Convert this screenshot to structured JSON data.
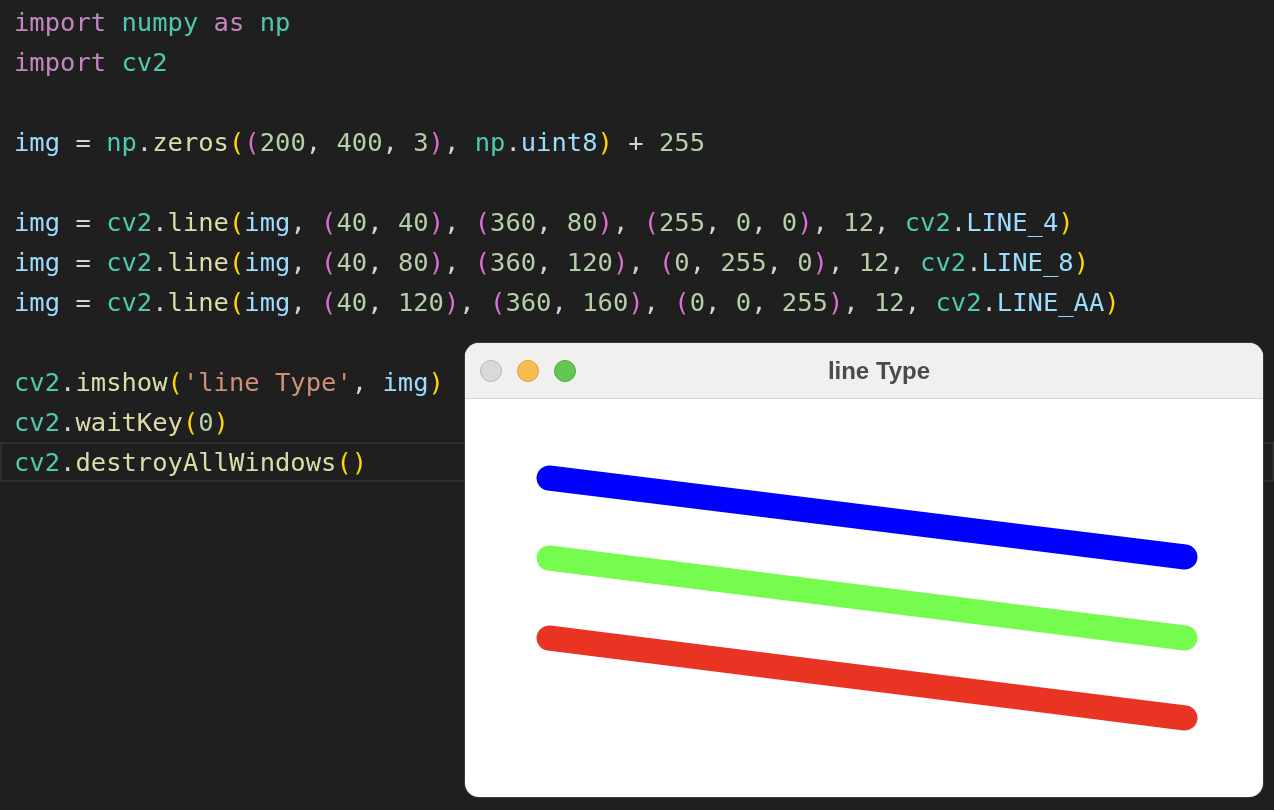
{
  "editor": {
    "lines": [
      {
        "kind": "code",
        "current": false,
        "tokens": [
          {
            "kind": "kw",
            "t": "import "
          },
          {
            "kind": "mod",
            "t": "numpy "
          },
          {
            "kind": "kw",
            "t": "as "
          },
          {
            "kind": "mod",
            "t": "np"
          }
        ]
      },
      {
        "kind": "code",
        "current": false,
        "tokens": [
          {
            "kind": "kw",
            "t": "import "
          },
          {
            "kind": "mod",
            "t": "cv2"
          }
        ]
      },
      {
        "kind": "blank",
        "current": false
      },
      {
        "kind": "code",
        "current": false,
        "tokens": [
          {
            "kind": "var",
            "t": "img"
          },
          {
            "kind": "op",
            "t": " = "
          },
          {
            "kind": "mod",
            "t": "np"
          },
          {
            "kind": "op",
            "t": "."
          },
          {
            "kind": "fn",
            "t": "zeros"
          },
          {
            "kind": "p1",
            "t": "("
          },
          {
            "kind": "p2",
            "t": "("
          },
          {
            "kind": "num",
            "t": "200"
          },
          {
            "kind": "op",
            "t": ", "
          },
          {
            "kind": "num",
            "t": "400"
          },
          {
            "kind": "op",
            "t": ", "
          },
          {
            "kind": "num",
            "t": "3"
          },
          {
            "kind": "p2",
            "t": ")"
          },
          {
            "kind": "op",
            "t": ", "
          },
          {
            "kind": "mod",
            "t": "np"
          },
          {
            "kind": "op",
            "t": "."
          },
          {
            "kind": "var",
            "t": "uint8"
          },
          {
            "kind": "p1",
            "t": ")"
          },
          {
            "kind": "op",
            "t": " + "
          },
          {
            "kind": "num",
            "t": "255"
          }
        ]
      },
      {
        "kind": "blank",
        "current": false
      },
      {
        "kind": "code",
        "current": false,
        "tokens": [
          {
            "kind": "var",
            "t": "img"
          },
          {
            "kind": "op",
            "t": " = "
          },
          {
            "kind": "mod",
            "t": "cv2"
          },
          {
            "kind": "op",
            "t": "."
          },
          {
            "kind": "fn",
            "t": "line"
          },
          {
            "kind": "p1",
            "t": "("
          },
          {
            "kind": "var",
            "t": "img"
          },
          {
            "kind": "op",
            "t": ", "
          },
          {
            "kind": "p2",
            "t": "("
          },
          {
            "kind": "num",
            "t": "40"
          },
          {
            "kind": "op",
            "t": ", "
          },
          {
            "kind": "num",
            "t": "40"
          },
          {
            "kind": "p2",
            "t": ")"
          },
          {
            "kind": "op",
            "t": ", "
          },
          {
            "kind": "p2",
            "t": "("
          },
          {
            "kind": "num",
            "t": "360"
          },
          {
            "kind": "op",
            "t": ", "
          },
          {
            "kind": "num",
            "t": "80"
          },
          {
            "kind": "p2",
            "t": ")"
          },
          {
            "kind": "op",
            "t": ", "
          },
          {
            "kind": "p2",
            "t": "("
          },
          {
            "kind": "num",
            "t": "255"
          },
          {
            "kind": "op",
            "t": ", "
          },
          {
            "kind": "num",
            "t": "0"
          },
          {
            "kind": "op",
            "t": ", "
          },
          {
            "kind": "num",
            "t": "0"
          },
          {
            "kind": "p2",
            "t": ")"
          },
          {
            "kind": "op",
            "t": ", "
          },
          {
            "kind": "num",
            "t": "12"
          },
          {
            "kind": "op",
            "t": ", "
          },
          {
            "kind": "mod",
            "t": "cv2"
          },
          {
            "kind": "op",
            "t": "."
          },
          {
            "kind": "var",
            "t": "LINE_4"
          },
          {
            "kind": "p1",
            "t": ")"
          }
        ]
      },
      {
        "kind": "code",
        "current": false,
        "tokens": [
          {
            "kind": "var",
            "t": "img"
          },
          {
            "kind": "op",
            "t": " = "
          },
          {
            "kind": "mod",
            "t": "cv2"
          },
          {
            "kind": "op",
            "t": "."
          },
          {
            "kind": "fn",
            "t": "line"
          },
          {
            "kind": "p1",
            "t": "("
          },
          {
            "kind": "var",
            "t": "img"
          },
          {
            "kind": "op",
            "t": ", "
          },
          {
            "kind": "p2",
            "t": "("
          },
          {
            "kind": "num",
            "t": "40"
          },
          {
            "kind": "op",
            "t": ", "
          },
          {
            "kind": "num",
            "t": "80"
          },
          {
            "kind": "p2",
            "t": ")"
          },
          {
            "kind": "op",
            "t": ", "
          },
          {
            "kind": "p2",
            "t": "("
          },
          {
            "kind": "num",
            "t": "360"
          },
          {
            "kind": "op",
            "t": ", "
          },
          {
            "kind": "num",
            "t": "120"
          },
          {
            "kind": "p2",
            "t": ")"
          },
          {
            "kind": "op",
            "t": ", "
          },
          {
            "kind": "p2",
            "t": "("
          },
          {
            "kind": "num",
            "t": "0"
          },
          {
            "kind": "op",
            "t": ", "
          },
          {
            "kind": "num",
            "t": "255"
          },
          {
            "kind": "op",
            "t": ", "
          },
          {
            "kind": "num",
            "t": "0"
          },
          {
            "kind": "p2",
            "t": ")"
          },
          {
            "kind": "op",
            "t": ", "
          },
          {
            "kind": "num",
            "t": "12"
          },
          {
            "kind": "op",
            "t": ", "
          },
          {
            "kind": "mod",
            "t": "cv2"
          },
          {
            "kind": "op",
            "t": "."
          },
          {
            "kind": "var",
            "t": "LINE_8"
          },
          {
            "kind": "p1",
            "t": ")"
          }
        ]
      },
      {
        "kind": "code",
        "current": false,
        "tokens": [
          {
            "kind": "var",
            "t": "img"
          },
          {
            "kind": "op",
            "t": " = "
          },
          {
            "kind": "mod",
            "t": "cv2"
          },
          {
            "kind": "op",
            "t": "."
          },
          {
            "kind": "fn",
            "t": "line"
          },
          {
            "kind": "p1",
            "t": "("
          },
          {
            "kind": "var",
            "t": "img"
          },
          {
            "kind": "op",
            "t": ", "
          },
          {
            "kind": "p2",
            "t": "("
          },
          {
            "kind": "num",
            "t": "40"
          },
          {
            "kind": "op",
            "t": ", "
          },
          {
            "kind": "num",
            "t": "120"
          },
          {
            "kind": "p2",
            "t": ")"
          },
          {
            "kind": "op",
            "t": ", "
          },
          {
            "kind": "p2",
            "t": "("
          },
          {
            "kind": "num",
            "t": "360"
          },
          {
            "kind": "op",
            "t": ", "
          },
          {
            "kind": "num",
            "t": "160"
          },
          {
            "kind": "p2",
            "t": ")"
          },
          {
            "kind": "op",
            "t": ", "
          },
          {
            "kind": "p2",
            "t": "("
          },
          {
            "kind": "num",
            "t": "0"
          },
          {
            "kind": "op",
            "t": ", "
          },
          {
            "kind": "num",
            "t": "0"
          },
          {
            "kind": "op",
            "t": ", "
          },
          {
            "kind": "num",
            "t": "255"
          },
          {
            "kind": "p2",
            "t": ")"
          },
          {
            "kind": "op",
            "t": ", "
          },
          {
            "kind": "num",
            "t": "12"
          },
          {
            "kind": "op",
            "t": ", "
          },
          {
            "kind": "mod",
            "t": "cv2"
          },
          {
            "kind": "op",
            "t": "."
          },
          {
            "kind": "var",
            "t": "LINE_AA"
          },
          {
            "kind": "p1",
            "t": ")"
          }
        ]
      },
      {
        "kind": "blank",
        "current": false
      },
      {
        "kind": "code",
        "current": false,
        "tokens": [
          {
            "kind": "mod",
            "t": "cv2"
          },
          {
            "kind": "op",
            "t": "."
          },
          {
            "kind": "fn",
            "t": "imshow"
          },
          {
            "kind": "p1",
            "t": "("
          },
          {
            "kind": "str",
            "t": "'line Type'"
          },
          {
            "kind": "op",
            "t": ", "
          },
          {
            "kind": "var",
            "t": "img"
          },
          {
            "kind": "p1",
            "t": ")"
          }
        ]
      },
      {
        "kind": "code",
        "current": false,
        "tokens": [
          {
            "kind": "mod",
            "t": "cv2"
          },
          {
            "kind": "op",
            "t": "."
          },
          {
            "kind": "fn",
            "t": "waitKey"
          },
          {
            "kind": "p1",
            "t": "("
          },
          {
            "kind": "num",
            "t": "0"
          },
          {
            "kind": "p1",
            "t": ")"
          }
        ]
      },
      {
        "kind": "code",
        "current": true,
        "tokens": [
          {
            "kind": "mod",
            "t": "cv2"
          },
          {
            "kind": "op",
            "t": "."
          },
          {
            "kind": "fn",
            "t": "destroyAllWindows"
          },
          {
            "kind": "p1",
            "t": "()"
          }
        ]
      }
    ]
  },
  "image_window": {
    "title": "line Type"
  }
}
